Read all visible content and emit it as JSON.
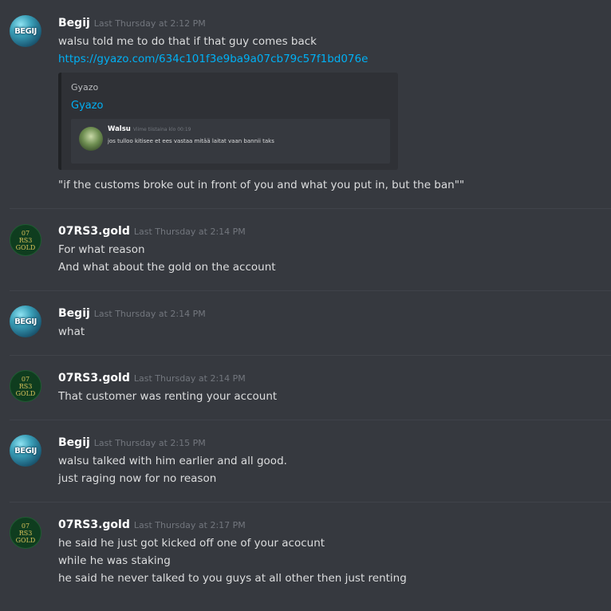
{
  "messages": [
    {
      "author": "Begij",
      "timestamp": "Last Thursday at 2:12 PM",
      "lines": [
        "walsu told me to do that if that guy comes back"
      ],
      "link": "https://gyazo.com/634c101f3e9ba9a07cb79c57f1bd076e",
      "embed": {
        "provider": "Gyazo",
        "title": "Gyazo",
        "inner_author": "Walsu",
        "inner_timestamp": "Viime tiistaina klo 00:19",
        "inner_text": "jos tulloo kitisee et ees vastaa mitää laitat vaan bannii taks"
      },
      "after_lines": [
        "\"if the customs broke out in front of you and what you put in, but the ban\"\""
      ]
    },
    {
      "author": "07RS3.gold",
      "timestamp": "Last Thursday at 2:14 PM",
      "lines": [
        "For what reason",
        "And what about the gold on the account"
      ]
    },
    {
      "author": "Begij",
      "timestamp": "Last Thursday at 2:14 PM",
      "lines": [
        "what"
      ]
    },
    {
      "author": "07RS3.gold",
      "timestamp": "Last Thursday at 2:14 PM",
      "lines": [
        "That customer was renting your account"
      ]
    },
    {
      "author": "Begij",
      "timestamp": "Last Thursday at 2:15 PM",
      "lines": [
        "walsu talked with him earlier and all good.",
        "just raging now for no reason"
      ]
    },
    {
      "author": "07RS3.gold",
      "timestamp": "Last Thursday at 2:17 PM",
      "lines": [
        "he said he just got kicked off one of your acocunt",
        "while he was staking",
        "he said he never talked to you guys at all other then just renting"
      ]
    }
  ],
  "avatars": {
    "begij_text": "BEGIJ",
    "osrs_lines": [
      "07",
      "RS3",
      "GOLD"
    ]
  },
  "colors": {
    "background": "#36393f",
    "link": "#00b0f4",
    "username": "#ffffff",
    "timestamp": "#72767d"
  }
}
